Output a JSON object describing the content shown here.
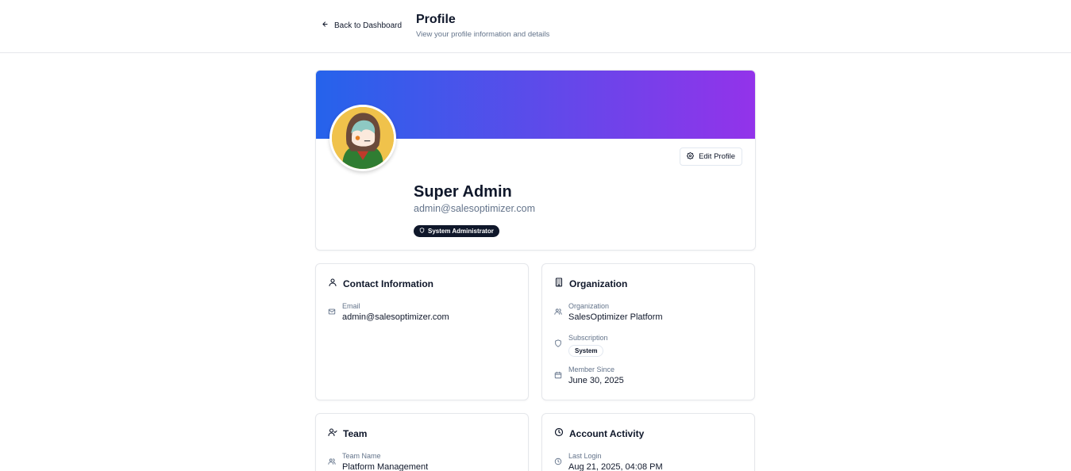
{
  "header": {
    "back_label": "Back to Dashboard",
    "title": "Profile",
    "subtitle": "View your profile information and details"
  },
  "profile": {
    "name": "Super Admin",
    "email": "admin@salesoptimizer.com",
    "role_badge": "System Administrator",
    "edit_label": "Edit Profile",
    "banner_colors": [
      "#2563eb",
      "#9333ea"
    ]
  },
  "contact": {
    "title": "Contact Information",
    "email_label": "Email",
    "email_value": "admin@salesoptimizer.com"
  },
  "organization": {
    "title": "Organization",
    "org_label": "Organization",
    "org_value": "SalesOptimizer Platform",
    "subscription_label": "Subscription",
    "subscription_value": "System",
    "member_label": "Member Since",
    "member_value": "June 30, 2025"
  },
  "team": {
    "title": "Team",
    "team_name_label": "Team Name",
    "team_name_value": "Platform Management"
  },
  "activity": {
    "title": "Account Activity",
    "last_login_label": "Last Login",
    "last_login_value": "Aug 21, 2025, 04:08 PM"
  },
  "icons": {
    "back": "arrow-left-icon",
    "edit": "gear-icon",
    "role": "shield-icon",
    "contact": "user-icon",
    "email": "mail-icon",
    "organization": "building-icon",
    "org_field": "users-icon",
    "subscription": "shield-icon",
    "member": "calendar-icon",
    "team": "user-check-icon",
    "team_name": "users-icon",
    "activity": "clock-icon",
    "last_login": "clock-icon"
  }
}
